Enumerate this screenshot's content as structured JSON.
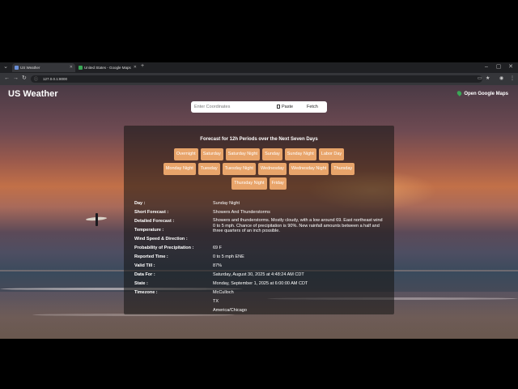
{
  "browser": {
    "tabs": [
      {
        "title": "US Weather",
        "active": true
      },
      {
        "title": "United States - Google Maps",
        "active": false
      }
    ],
    "url": "127.0.0.1:8000"
  },
  "app": {
    "title": "US Weather",
    "google_maps_link": "Open Google Maps"
  },
  "search": {
    "placeholder": "Enter Coordinates",
    "paste_label": "Paste",
    "fetch_label": "Fetch"
  },
  "forecast": {
    "heading": "Forecast for 12h Periods over the Next Seven Days",
    "periods_row1": [
      "Overnight",
      "Saturday",
      "Saturday Night",
      "Sunday",
      "Sunday Night",
      "Labor Day"
    ],
    "periods_row2": [
      "Monday Night",
      "Tuesday",
      "Tuesday Night",
      "Wednesday",
      "Wednesday Night",
      "Thursday"
    ],
    "periods_row3": [
      "Thursday Night",
      "Friday"
    ],
    "chip_color": "#e8a46a"
  },
  "details": {
    "labels": {
      "day": "Day :",
      "short": "Short Forecast :",
      "detailed": "Detailed Forecast :",
      "temperature": "Temperature :",
      "wind": "Wind Speed & Direction :",
      "precip": "Probability of Precipitation :",
      "reported": "Reported Time :",
      "valid": "Valid Till :",
      "data_for": "Data For :",
      "state": "State :",
      "timezone": "Timezone :"
    },
    "values": {
      "day": "Sunday Night",
      "short": "Showers And Thunderstorms",
      "detailed": "Showers and thunderstorms. Mostly cloudy, with a low around 69. East northeast wind 0 to 5 mph. Chance of precipitation is 90%. New rainfall amounts between a half and three quarters of an inch possible.",
      "temperature": "69 F",
      "wind": "0 to 5 mph ENE",
      "precip": "87%",
      "reported": "Saturday, August 30, 2025 at 4:48:24 AM CDT",
      "valid": "Monday, September 1, 2025 at 6:00:00 AM CDT",
      "data_for": "McCulloch",
      "state": "TX",
      "timezone": "America/Chicago"
    }
  }
}
